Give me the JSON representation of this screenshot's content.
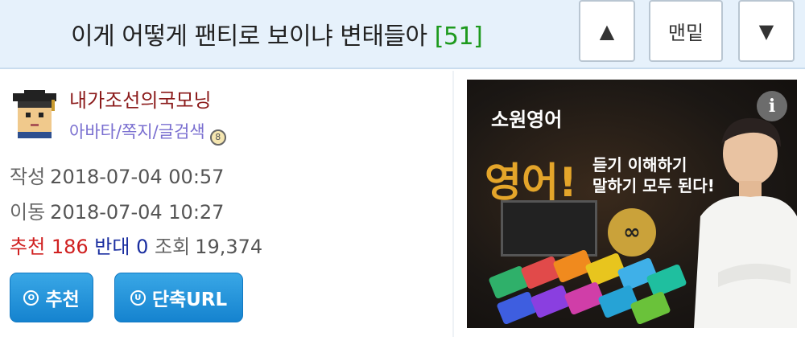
{
  "header": {
    "title": "이게 어떻게 팬티로 보이냐 변태들아",
    "comment_count": "[51]",
    "up_label": "▲",
    "bottom_label": "맨밑",
    "down_label": "▼"
  },
  "author": {
    "nickname": "내가조선의국모닝",
    "sublinks": "아바타/쪽지/글검색"
  },
  "meta": {
    "written_label": "작성",
    "written_value": "2018-07-04 00:57",
    "moved_label": "이동",
    "moved_value": "2018-07-04 10:27",
    "recommend_label": "추천",
    "recommend_value": "186",
    "oppose_label": "반대",
    "oppose_value": "0",
    "views_label": "조회",
    "views_value": "19,374"
  },
  "buttons": {
    "recommend_label": "추천",
    "shorturl_label": "단축URL"
  },
  "ad": {
    "brand": "소원영어",
    "headline": "영어!",
    "line1": "듣기 이해하기",
    "line2": "말하기 모두 된다!",
    "info_label": "i",
    "infinity": "∞"
  },
  "colors": {
    "header_bg": "#e6f1fb",
    "count_green": "#1e9a1e",
    "nickname": "#8b1a1a",
    "link_purple": "#7a6fd0",
    "recommend_red": "#d02020",
    "oppose_blue": "#1a2ea0",
    "button_blue": "#1583cf"
  },
  "icons": [
    "up-arrow-icon",
    "down-arrow-icon",
    "avatar-graduate-icon",
    "badge-icon",
    "circle-o-icon",
    "circle-u-icon",
    "info-icon"
  ]
}
